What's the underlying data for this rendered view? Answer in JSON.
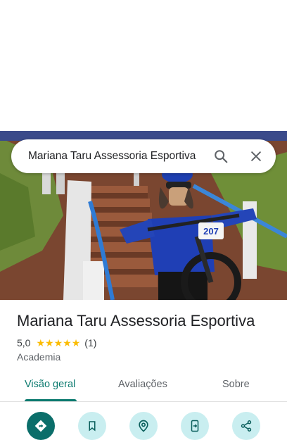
{
  "search": {
    "query": "Mariana Taru Assessoria Esportiva",
    "search_icon": "magnifier-icon",
    "close_icon": "close-icon"
  },
  "hero": {
    "bib_number": "207"
  },
  "place": {
    "title": "Mariana Taru Assessoria Esportiva",
    "rating": "5,0",
    "stars": 5,
    "review_count": "(1)",
    "category": "Academia"
  },
  "tabs": [
    {
      "label": "Visão geral",
      "active": true
    },
    {
      "label": "Avaliações",
      "active": false
    },
    {
      "label": "Sobre",
      "active": false
    }
  ],
  "actions": [
    {
      "icon": "directions-icon"
    },
    {
      "icon": "bookmark-icon"
    },
    {
      "icon": "nearby-icon"
    },
    {
      "icon": "send-to-phone-icon"
    },
    {
      "icon": "share-icon"
    }
  ],
  "colors": {
    "accent": "#0b7a6f",
    "star": "#fbbc04",
    "action_bg": "#c9eef0",
    "primary_action_bg": "#0b6e6a"
  }
}
